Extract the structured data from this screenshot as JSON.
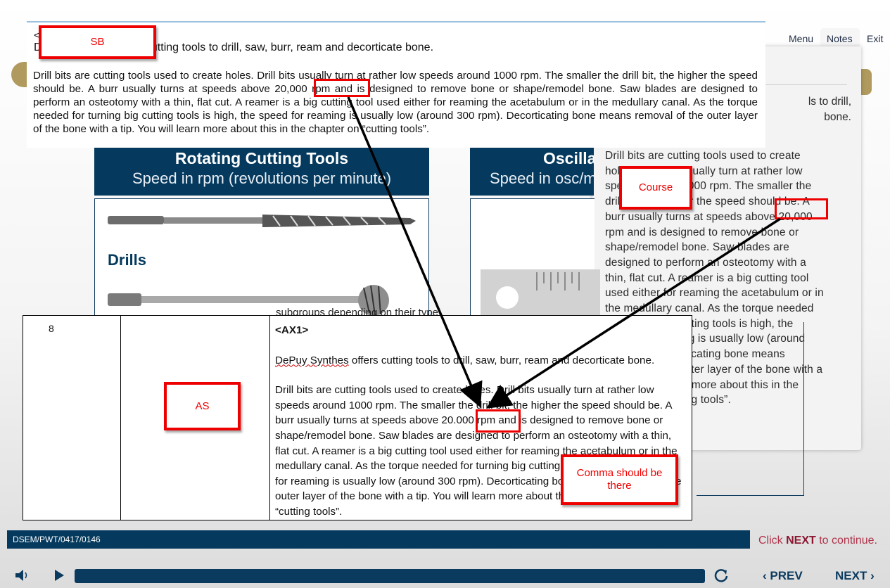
{
  "nav": {
    "menu": "Menu",
    "notes": "Notes",
    "exit": "Exit"
  },
  "notes_panel": {
    "fragment_top": "ls to drill,\nbone.",
    "paragraph": "Drill bits are cutting tools used to create holes. Drill bits usually turn at rather low speeds around 1000 rpm. The smaller the drill bit, the higher the speed should be. A burr usually turns at speeds above 20,000 rpm and is designed to remove bone or shape/remodel bone. Saw blades are designed to perform an osteotomy with a thin, flat cut. A reamer is a big cutting tool used either for reaming the acetabulum or in the medullary canal. As the torque needed for turning big cutting tools is high, the speed for reaming is usually low (around 300 rpm). Decorticating bone means removal of the outer layer of the bone with a tip. You will learn more about this in the chapter on “cutting tools”."
  },
  "slide": {
    "rotating_title": "Rotating Cutting Tools",
    "rotating_subtitle": "Speed in rpm (revolutions per minute)",
    "oscillating_title": "Oscilla",
    "oscillating_subtitle": "Speed in osc/m",
    "drills_label": "Drills",
    "subgroups_fragment": "subgroups depending on their type."
  },
  "sb_document": {
    "heading_char": "<",
    "line1": "DePuy Synthes offers cutting tools to drill, saw, burr, ream and decorticate bone.",
    "paragraph": "Drill bits are cutting tools used to create holes. Drill bits usually turn at rather low speeds around 1000 rpm. The smaller the drill bit, the higher the speed should be. A burr usually turns at speeds above 20,000 rpm and is designed to remove bone or shape/remodel bone. Saw blades are designed to perform an osteotomy with a thin, flat cut. A reamer is a big cutting tool used either for reaming the acetabulum or in the medullary canal. As the torque needed for turning big cutting tools is high, the speed for reaming is usually low (around 300 rpm). Decorticating bone means removal of the outer layer of the bone with a tip. You will learn more about this in the chapter on “cutting tools”."
  },
  "as_document": {
    "row_number": "8",
    "tag": "<AX1>",
    "brand": "DePuy Synthes",
    "line1_rest": " offers cutting tools to drill, saw, burr, ream and decorticate bone.",
    "paragraph": "Drill bits are cutting tools used to create holes. Drill bits usually turn at rather low speeds around 1000 rpm. The smaller the drill bit, the higher the speed should be. A burr usually turns at speeds above 20.000 rpm and is designed to remove bone or shape/remodel bone. Saw blades are designed to perform an osteotomy with a thin, flat cut. A reamer is a big cutting tool used either for reaming the acetabulum or in the medullary canal. As the torque needed for turning big cutting tools is high, the speed for reaming is usually low (around 300 rpm). Decorticating bone means removal of the outer layer of the bone with a tip. You will learn more about this in the chapter on “cutting tools”."
  },
  "annotations": {
    "sb": "SB",
    "as": "AS",
    "course": "Course",
    "comment": "Comma should be there",
    "highlight_color": "#e00000"
  },
  "footer": {
    "code": "DSEM/PWT/0417/0146",
    "click": "Click ",
    "next_word": "NEXT",
    "to_continue": " to continue."
  },
  "controls": {
    "prev": "PREV",
    "next": "NEXT",
    "icons": [
      "speaker-icon",
      "play-icon",
      "replay-icon",
      "chevron-left-icon",
      "chevron-right-icon"
    ]
  },
  "colors": {
    "navy": "#053a5e",
    "gold": "#b09a5e",
    "next_red": "#8a1630"
  }
}
